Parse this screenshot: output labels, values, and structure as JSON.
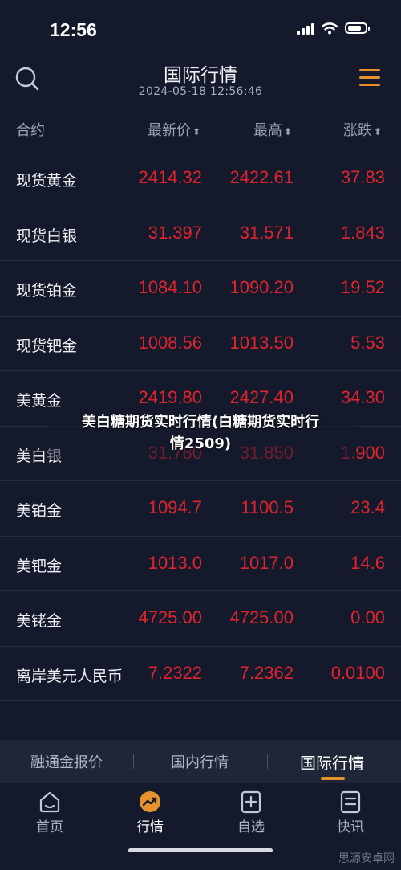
{
  "status_bar": {
    "time": "12:56"
  },
  "header": {
    "title": "国际行情",
    "datetime": "2024-05-18 12:56:46"
  },
  "columns": {
    "contract": "合约",
    "last_price": "最新价",
    "high": "最高",
    "change": "涨跌",
    "sort_glyph": "⬍"
  },
  "rows": [
    {
      "name": "现货黄金",
      "last": "2414.32",
      "high": "2422.61",
      "change": "37.83"
    },
    {
      "name": "现货白银",
      "last": "31.397",
      "high": "31.571",
      "change": "1.843"
    },
    {
      "name": "现货铂金",
      "last": "1084.10",
      "high": "1090.20",
      "change": "19.52"
    },
    {
      "name": "现货钯金",
      "last": "1008.56",
      "high": "1013.50",
      "change": "5.53"
    },
    {
      "name": "美黄金",
      "last": "2419.80",
      "high": "2427.40",
      "change": "34.30"
    },
    {
      "name": "美白银",
      "last": "31.780",
      "high": "31.850",
      "change": "1.900"
    },
    {
      "name": "美铂金",
      "last": "1094.7",
      "high": "1100.5",
      "change": "23.4"
    },
    {
      "name": "美钯金",
      "last": "1013.0",
      "high": "1017.0",
      "change": "14.6"
    },
    {
      "name": "美铑金",
      "last": "4725.00",
      "high": "4725.00",
      "change": "0.00"
    },
    {
      "name": "离岸美元人民币",
      "last": "7.2322",
      "high": "7.2362",
      "change": "0.0100"
    }
  ],
  "overlay": {
    "line1": "美白糖期货实时行情(白糖期货实时行",
    "line2": "情2509)"
  },
  "tabs": [
    "融通金报价",
    "国内行情",
    "国际行情"
  ],
  "active_tab": "国际行情",
  "bottom_nav": [
    {
      "label": "首页",
      "icon": "home-icon"
    },
    {
      "label": "行情",
      "icon": "market-trend-icon"
    },
    {
      "label": "自选",
      "icon": "add-watchlist-icon"
    },
    {
      "label": "快讯",
      "icon": "news-icon"
    }
  ],
  "active_nav": "行情",
  "watermark": "思源安卓网",
  "colors": {
    "background": "#141a2b",
    "price_red": "#e0242e",
    "accent_orange": "#e5922d"
  }
}
